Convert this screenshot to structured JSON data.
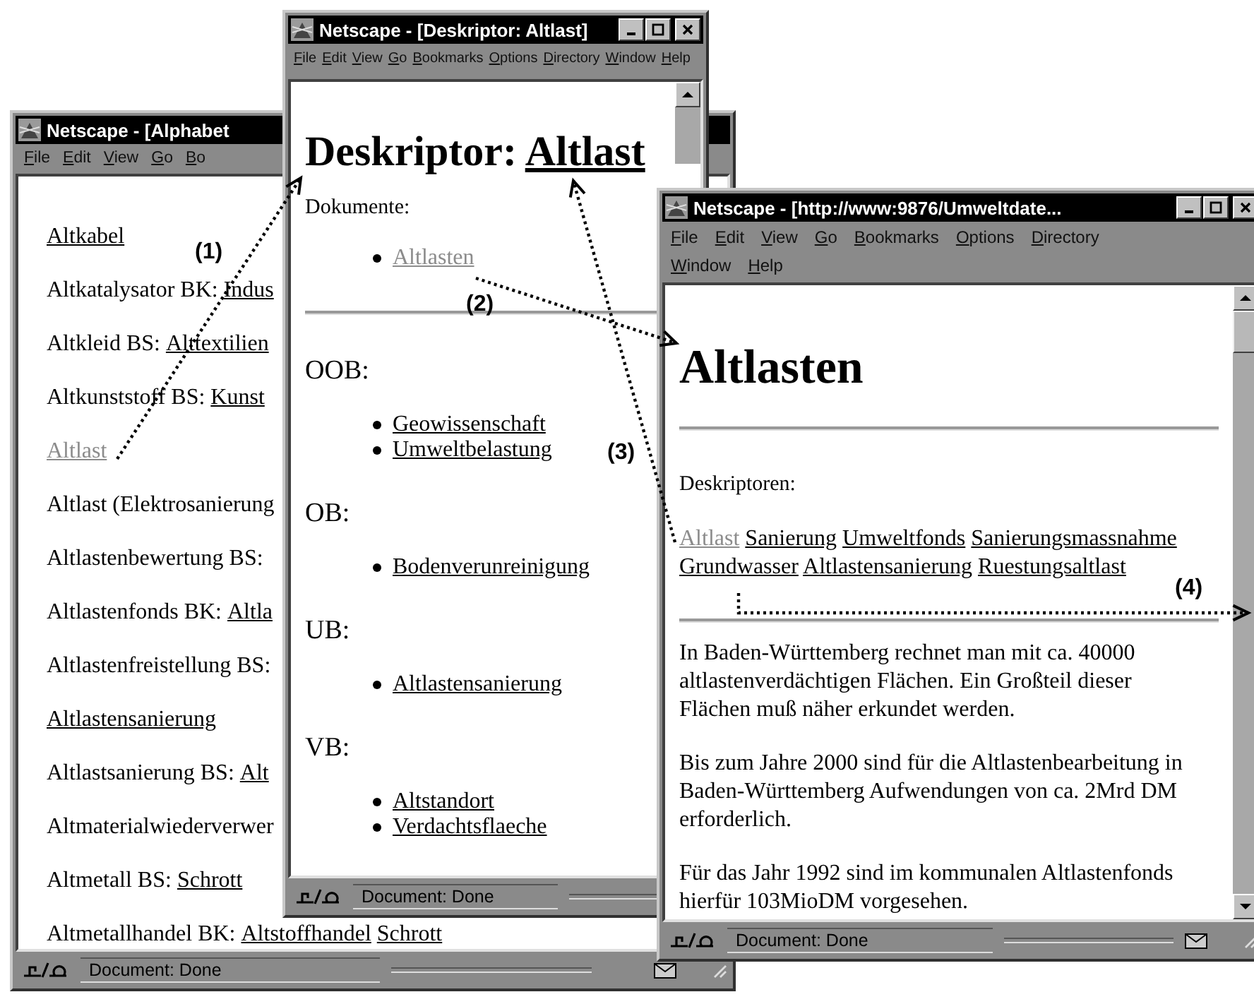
{
  "windows": [
    {
      "kind": "alphabet",
      "title": "Netscape - [Alphabet",
      "menu": [
        "File",
        "Edit",
        "View",
        "Go",
        "Bo"
      ],
      "entries": [
        {
          "links": [
            {
              "text": "Altkabel",
              "visited": false
            }
          ]
        },
        {
          "label": "Altkatalysator BK:",
          "links": [
            {
              "text": "Indus",
              "visited": false
            }
          ]
        },
        {
          "label": "Altkleid BS:",
          "links": [
            {
              "text": "Alttextilien",
              "visited": false
            }
          ]
        },
        {
          "label": "Altkunststoff BS:",
          "links": [
            {
              "text": "Kunst",
              "visited": false
            }
          ]
        },
        {
          "links": [
            {
              "text": "Altlast",
              "visited": true
            }
          ]
        },
        {
          "label": "Altlast (Elektrosanierung"
        },
        {
          "label": "Altlastenbewertung BS:"
        },
        {
          "label": "Altlastenfonds BK:",
          "links": [
            {
              "text": "Altla",
              "visited": false
            }
          ]
        },
        {
          "label": "Altlastenfreistellung BS:"
        },
        {
          "links": [
            {
              "text": "Altlastensanierung",
              "visited": false
            }
          ]
        },
        {
          "label": "Altlastsanierung BS:",
          "links": [
            {
              "text": "Alt",
              "visited": false
            }
          ]
        },
        {
          "label": "Altmaterialwiederverwer"
        },
        {
          "label": "Altmetall BS:",
          "links": [
            {
              "text": "Schrott",
              "visited": false
            }
          ]
        },
        {
          "label": "Altmetallhandel BK:",
          "links": [
            {
              "text": "Altstoffhandel",
              "visited": false
            },
            {
              "text": "Schrott",
              "visited": false
            }
          ]
        }
      ],
      "status": "Document: Done",
      "mail": true
    },
    {
      "kind": "descriptor",
      "title": "Netscape - [Deskriptor: Altlast]",
      "title_buttons": true,
      "menu": [
        "File",
        "Edit",
        "View",
        "Go",
        "Bookmarks",
        "Options",
        "Directory",
        "Window",
        "Help"
      ],
      "heading": "Deskriptor:",
      "heading_link": "Altlast",
      "documents_label": "Dokumente:",
      "documents": [
        {
          "text": "Altlasten",
          "visited": true
        }
      ],
      "sections": [
        {
          "label": "OOB:",
          "links": [
            {
              "text": "Geowissenschaft",
              "visited": false
            },
            {
              "text": "Umweltbelastung",
              "visited": false
            }
          ]
        },
        {
          "label": "OB:",
          "links": [
            {
              "text": "Bodenverunreinigung",
              "visited": false
            }
          ]
        },
        {
          "label": "UB:",
          "links": [
            {
              "text": "Altlastensanierung",
              "visited": false
            }
          ]
        },
        {
          "label": "VB:",
          "links": [
            {
              "text": "Altstandort",
              "visited": false
            },
            {
              "text": "Verdachtsflaeche",
              "visited": false
            }
          ]
        }
      ],
      "status": "Document: Done"
    },
    {
      "kind": "document",
      "title": "Netscape - [http://www:9876/Umweltdate...",
      "title_buttons": true,
      "menu": [
        "File",
        "Edit",
        "View",
        "Go",
        "Bookmarks",
        "Options",
        "Directory",
        "Window",
        "Help"
      ],
      "heading": "Altlasten",
      "descriptors_label": "Deskriptoren:",
      "descriptors": [
        {
          "text": "Altlast",
          "visited": true
        },
        {
          "text": "Sanierung",
          "visited": false
        },
        {
          "text": "Umweltfonds",
          "visited": false
        },
        {
          "text": "Sanierungsmassnahme",
          "visited": false
        },
        {
          "text": "Grundwasser",
          "visited": false
        },
        {
          "text": "Altlastensanierung",
          "visited": false
        },
        {
          "text": "Ruestungsaltlast",
          "visited": false
        }
      ],
      "paragraphs": [
        "In Baden-Württemberg rechnet man mit ca. 40000 altlastenverdächtigen Flächen. Ein Großteil dieser Flächen muß näher erkundet werden.",
        "Bis zum Jahre 2000 sind für die Altlastenbearbeitung in Baden-Württemberg Aufwendungen von ca. 2Mrd DM erforderlich.",
        "Für das Jahr 1992 sind im kommunalen Altlastenfonds hierfür 103MioDM vorgesehen."
      ],
      "status": "Document: Done",
      "mail": true
    }
  ],
  "arrows": [
    {
      "label": "(1)"
    },
    {
      "label": "(2)"
    },
    {
      "label": "(3)"
    },
    {
      "label": "(4)"
    }
  ]
}
